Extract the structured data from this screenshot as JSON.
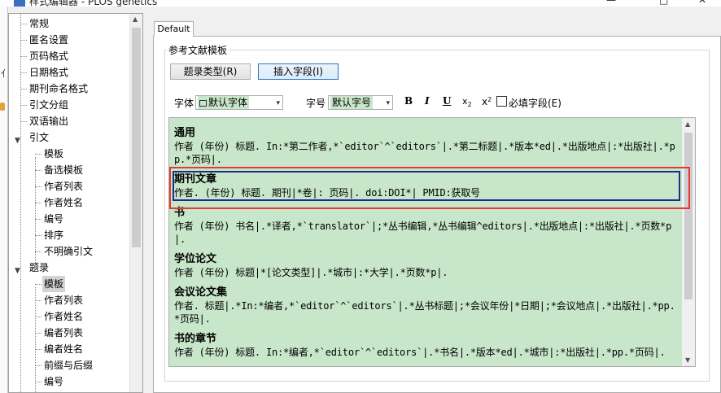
{
  "window": {
    "title": "样式编辑器 - PLOS genetics",
    "controls": {
      "minimize": "—",
      "maximize": "□",
      "close": "✕"
    },
    "underlying_glyph": "亻"
  },
  "tree": {
    "items": [
      {
        "label": "常规",
        "level": 0
      },
      {
        "label": "匿名设置",
        "level": 0
      },
      {
        "label": "页码格式",
        "level": 0
      },
      {
        "label": "日期格式",
        "level": 0
      },
      {
        "label": "期刊命名格式",
        "level": 0
      },
      {
        "label": "引文分组",
        "level": 0
      },
      {
        "label": "双语输出",
        "level": 0
      },
      {
        "label": "引文",
        "level": 0,
        "expanded": true
      },
      {
        "label": "模板",
        "level": 1
      },
      {
        "label": "备选模板",
        "level": 1
      },
      {
        "label": "作者列表",
        "level": 1
      },
      {
        "label": "作者姓名",
        "level": 1
      },
      {
        "label": "编号",
        "level": 1
      },
      {
        "label": "排序",
        "level": 1
      },
      {
        "label": "不明确引文",
        "level": 1
      },
      {
        "label": "题录",
        "level": 0,
        "expanded": true
      },
      {
        "label": "模板",
        "level": 1,
        "selected": true
      },
      {
        "label": "作者列表",
        "level": 1
      },
      {
        "label": "作者姓名",
        "level": 1
      },
      {
        "label": "编者列表",
        "level": 1
      },
      {
        "label": "编者姓名",
        "level": 1
      },
      {
        "label": "前缀与后缀",
        "level": 1
      },
      {
        "label": "编号",
        "level": 1
      }
    ]
  },
  "tab": {
    "label": "Default"
  },
  "group": {
    "title": "参考文献模板"
  },
  "buttons": {
    "ref_type": "题录类型(R)",
    "insert_field": "插入字段(I)"
  },
  "font": {
    "label": "字体",
    "value": "默认字体",
    "size_label": "字号",
    "size_value": "默认字号",
    "bold": "B",
    "italic": "I",
    "underline": "U",
    "subscript": "x",
    "subscript_mark": "2",
    "superscript": "x",
    "superscript_mark": "2",
    "required_label": "必填字段(E)"
  },
  "templates": [
    {
      "type": "通用",
      "format": "作者 (年份) 标题. In:*第二作者,*`editor`^`editors`|.*第二标题|.*版本*ed|.*出版地点|:*出版社|.*pp.*页码|."
    },
    {
      "type": "期刊文章",
      "format": "作者. (年份) 标题. 期刊|*卷|: 页码|. doi:DOI*| PMID:获取号",
      "selected": true
    },
    {
      "type": "书",
      "format": "作者 (年份) 书名|.*译者,*`translator`|;*丛书编辑,*丛书编辑^editors|.*出版地点|:*出版社|.*页数*p|."
    },
    {
      "type": "学位论文",
      "format": "作者 (年份) 标题|*[论文类型]|.*城市|:*大学|.*页数*p|."
    },
    {
      "type": "会议论文集",
      "format": "作者. 标题|.*In:*编者,*`editor`^`editors`|.*丛书标题|;*会议年份|*日期|;*会议地点|.*出版社|.*pp.*页码|."
    },
    {
      "type": "书的章节",
      "format": "作者 (年份) 标题. In:*编者,*`editor`^`editors`|.*书名|.*版本*ed|.*城市|:*出版社|.*pp.*页码|."
    }
  ],
  "colors": {
    "editor_bg": "#c8e6c9",
    "selection_border": "#1a2f8a",
    "highlight": "#e53935",
    "focus_button": "#2a75c8"
  }
}
